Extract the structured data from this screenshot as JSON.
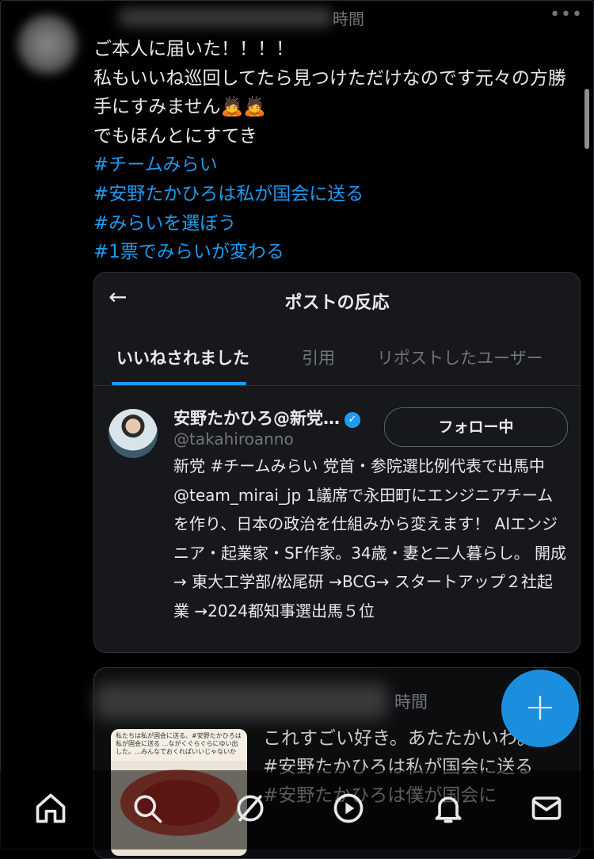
{
  "tweet": {
    "time": "時間",
    "more_label": "•••",
    "lines": [
      "ご本人に届いた！！！！",
      "私もいいね巡回してたら見つけただけなのです元々の方勝手にすみません🙇🙇",
      "でもほんとにすてき"
    ],
    "hashtags": [
      "#チームみらい",
      "#安野たかひろは私が国会に送る",
      "#みらいを選ぼう",
      "#1票でみらいが変わる"
    ]
  },
  "card": {
    "back_label": "←",
    "title": "ポストの反応",
    "tabs": [
      {
        "label": "いいねされました",
        "active": true
      },
      {
        "label": "引用",
        "active": false
      },
      {
        "label": "リポストしたユーザー",
        "active": false
      }
    ],
    "user": {
      "name": "安野たかひろ@新党…",
      "verified_label": "✓",
      "handle": "@takahiroanno",
      "follow_label": "フォロー中",
      "bio": "新党 #チームみらい 党首・参院選比例代表で出馬中 @team_mirai_jp 1議席で永田町にエンジニアチームを作り、日本の政治を仕組みから変えます！ AIエンジニア・起業家・SF作家。34歳・妻と二人暮らし。 開成 → 東大工学部/松尾研 →BCG→ スタートアップ２社起業 →2024都知事選出馬５位"
    }
  },
  "tweet2": {
    "time": "時間",
    "thumb_caption": "私たちは私が国会に送る、#安野たかひろは私が国会に送る …ながくぐらぐらにゆい出した。…みんなでおくればいいじゃないか",
    "text": "これすごい好き。あたたかいわ。 #安野たかひろは私が国会に送る #安野たかひろは僕が国会に"
  },
  "fab_label": "+",
  "nav": [
    "home-icon",
    "search-icon",
    "grok-icon",
    "video-icon",
    "notifications-icon",
    "messages-icon"
  ]
}
